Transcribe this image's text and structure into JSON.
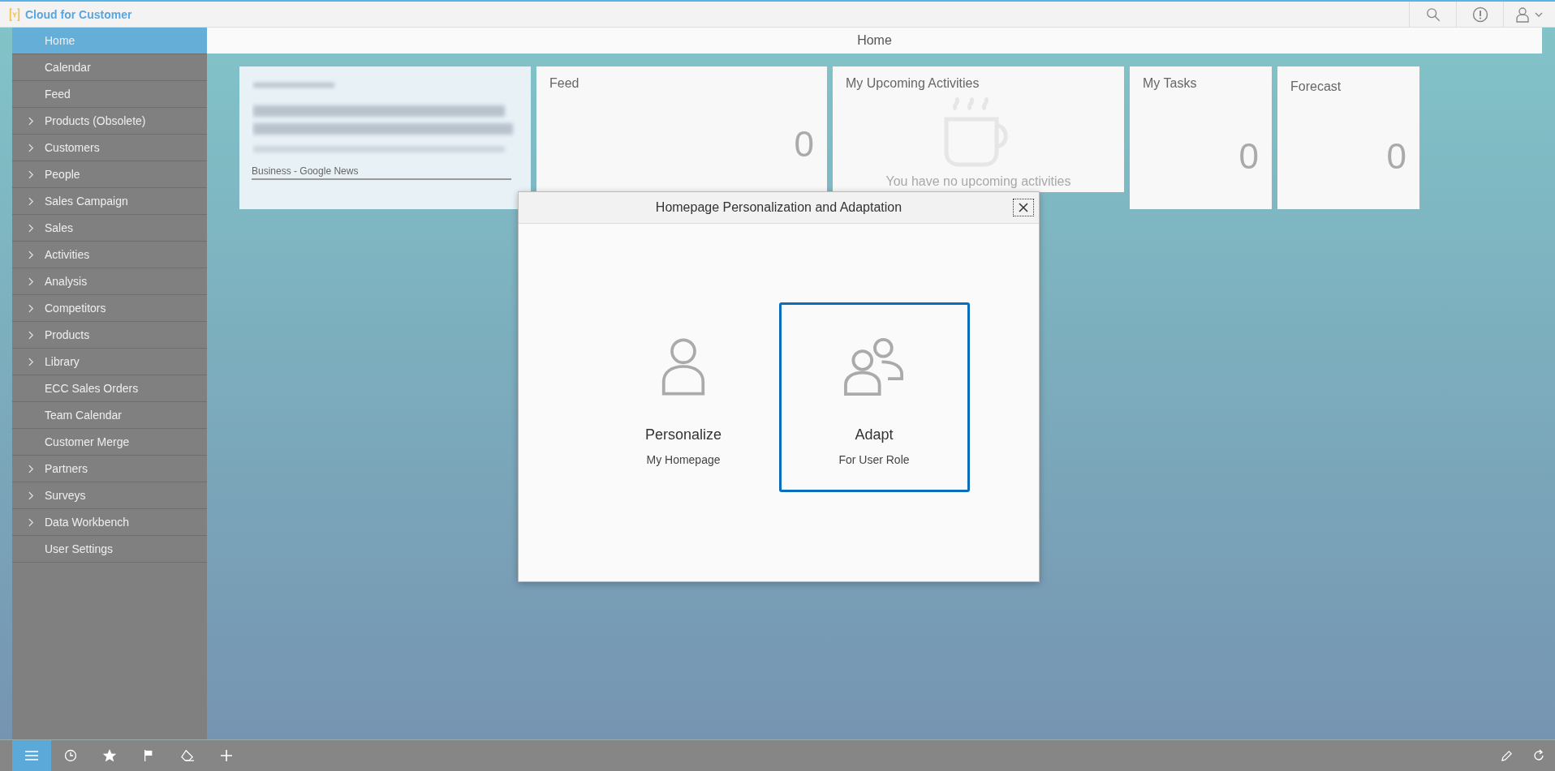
{
  "header": {
    "title": "Cloud for Customer"
  },
  "sidebar": {
    "items": [
      {
        "label": "Home",
        "selected": true,
        "expandable": false
      },
      {
        "label": "Calendar",
        "selected": false,
        "expandable": false
      },
      {
        "label": "Feed",
        "selected": false,
        "expandable": false
      },
      {
        "label": "Products (Obsolete)",
        "selected": false,
        "expandable": true
      },
      {
        "label": "Customers",
        "selected": false,
        "expandable": true
      },
      {
        "label": "People",
        "selected": false,
        "expandable": true
      },
      {
        "label": "Sales Campaign",
        "selected": false,
        "expandable": true
      },
      {
        "label": "Sales",
        "selected": false,
        "expandable": true
      },
      {
        "label": "Activities",
        "selected": false,
        "expandable": true
      },
      {
        "label": "Analysis",
        "selected": false,
        "expandable": true
      },
      {
        "label": "Competitors",
        "selected": false,
        "expandable": true
      },
      {
        "label": "Products",
        "selected": false,
        "expandable": true
      },
      {
        "label": "Library",
        "selected": false,
        "expandable": true
      },
      {
        "label": "ECC Sales Orders",
        "selected": false,
        "expandable": false
      },
      {
        "label": "Team Calendar",
        "selected": false,
        "expandable": false
      },
      {
        "label": "Customer Merge",
        "selected": false,
        "expandable": false
      },
      {
        "label": "Partners",
        "selected": false,
        "expandable": true
      },
      {
        "label": "Surveys",
        "selected": false,
        "expandable": true
      },
      {
        "label": "Data Workbench",
        "selected": false,
        "expandable": true
      },
      {
        "label": "User Settings",
        "selected": false,
        "expandable": false
      }
    ]
  },
  "page": {
    "title": "Home"
  },
  "tiles": [
    {
      "kind": "news",
      "source": "Business - Google News"
    },
    {
      "kind": "count",
      "title": "Feed",
      "value": "0"
    },
    {
      "kind": "empty",
      "title": "My Upcoming Activities",
      "message": "You have no upcoming activities"
    },
    {
      "kind": "count",
      "title": "My Tasks",
      "value": "0"
    },
    {
      "kind": "count",
      "title": "Forecast",
      "value": "0"
    }
  ],
  "dialog": {
    "title": "Homepage Personalization and Adaptation",
    "options": [
      {
        "kind": "single",
        "title": "Personalize",
        "subtitle": "My Homepage",
        "selected": false
      },
      {
        "kind": "group",
        "title": "Adapt",
        "subtitle": "For User Role",
        "selected": true
      }
    ]
  },
  "bottom_bar": {
    "tabs": [
      {
        "kind": "menu",
        "selected": true
      },
      {
        "kind": "clock",
        "selected": false
      },
      {
        "kind": "star",
        "selected": false
      },
      {
        "kind": "flag",
        "selected": false
      },
      {
        "kind": "eraser",
        "selected": false
      }
    ]
  }
}
